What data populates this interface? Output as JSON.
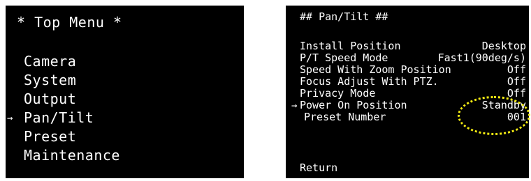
{
  "left_screen": {
    "title": "* Top Menu *",
    "cursor": "→",
    "items": [
      "Camera",
      "System",
      "Output",
      "Pan/Tilt",
      "Preset",
      "Maintenance"
    ]
  },
  "right_screen": {
    "title": "## Pan/Tilt ##",
    "cursor": "→",
    "rows": [
      {
        "label": "Install Position",
        "value": "Desktop"
      },
      {
        "label": "P/T Speed Mode",
        "value": "Fast1(90deg/s)"
      },
      {
        "label": "Speed With Zoom Position",
        "value": "Off"
      },
      {
        "label": "Focus Adjust With PTZ.",
        "value": "Off"
      },
      {
        "label": "Privacy Mode",
        "value": "Off"
      },
      {
        "label": "Power On Position",
        "value": "Standby"
      },
      {
        "label": "Preset Number",
        "value": "001"
      }
    ],
    "return_label": "Return",
    "highlight_color": "#f2ea12"
  }
}
